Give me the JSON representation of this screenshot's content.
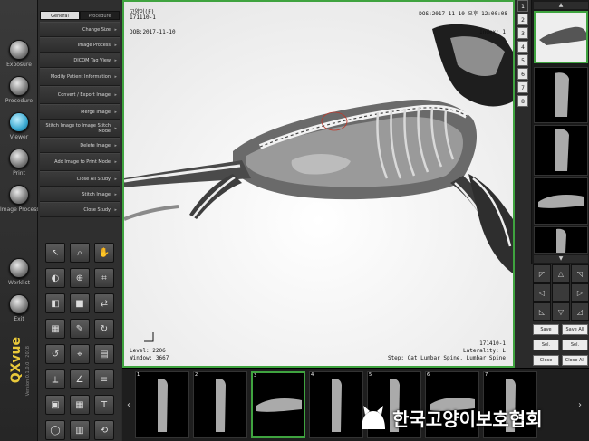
{
  "app": {
    "name": "QXvue",
    "version": "Version 0.1.0.0 - 2018"
  },
  "rail": [
    {
      "id": "exposure",
      "label": "Exposure"
    },
    {
      "id": "procedure",
      "label": "Procedure"
    },
    {
      "id": "viewer",
      "label": "Viewer",
      "active": true
    },
    {
      "id": "print",
      "label": "Print"
    },
    {
      "id": "image-process",
      "label": "Image Process"
    },
    {
      "id": "worklist",
      "label": "Worklist"
    },
    {
      "id": "exit",
      "label": "Exit"
    }
  ],
  "panel": {
    "tabs": [
      {
        "label": "General",
        "active": true
      },
      {
        "label": "Procedure"
      }
    ],
    "menu": [
      {
        "label": "Change Size"
      },
      {
        "label": "Image Process"
      },
      {
        "label": "DICOM Tag View"
      },
      {
        "label": "Modify Patient Information"
      },
      {
        "label": "Convert / Export Image"
      },
      {
        "label": "Merge Image"
      },
      {
        "label": "Stitch Image to Image Stitch Mode"
      },
      {
        "label": "Delete Image"
      },
      {
        "label": "Add Image to Print Mode"
      },
      {
        "label": "Close All Study"
      },
      {
        "label": "Stitch Image"
      },
      {
        "label": "Close Study"
      }
    ],
    "tools": [
      "pointer-icon",
      "zoom-icon",
      "pan-hand-icon",
      "window-level-icon",
      "magnify-icon",
      "crop-icon",
      "invert-icon",
      "square-icon",
      "flip-icon",
      "grid-icon",
      "annotation-icon",
      "rotate-icon",
      "rotate-left-icon",
      "measure-icon",
      "film-icon",
      "ruler-icon",
      "angle-icon",
      "cobb-icon",
      "lock-icon",
      "grid-icon",
      "text-icon",
      "roi-icon",
      "layout-icon",
      "reset-icon"
    ]
  },
  "viewer": {
    "patient_name": "고양이(F)",
    "patient_id": "171110-1",
    "study_date": "DOB:2017-11-10",
    "datetime": "DOS:2017-11-10 오후 12:00:08",
    "stage_label": "Index: 1",
    "level": "Level: 2206",
    "window": "Window: 3667",
    "series": "171410-1",
    "laterality": "Laterality: L",
    "body_part": "Step: Cat Lumbar Spine, Lumbar Spine"
  },
  "numstrip": [
    "1",
    "2",
    "3",
    "4",
    "5",
    "6",
    "7",
    "8"
  ],
  "numstrip_selected": 0,
  "navpad": [
    "◸",
    "△",
    "◹",
    "◁",
    "",
    "▷",
    "◺",
    "▽",
    "◿"
  ],
  "side_buttons": [
    "Save",
    "Save All",
    "Sel.",
    "Sel.",
    "Close",
    "Close All"
  ],
  "strip": {
    "thumbs": [
      "1",
      "2",
      "3",
      "4",
      "5",
      "6",
      "7"
    ],
    "selected": 2,
    "watermark": "한국고양이보호협회"
  }
}
